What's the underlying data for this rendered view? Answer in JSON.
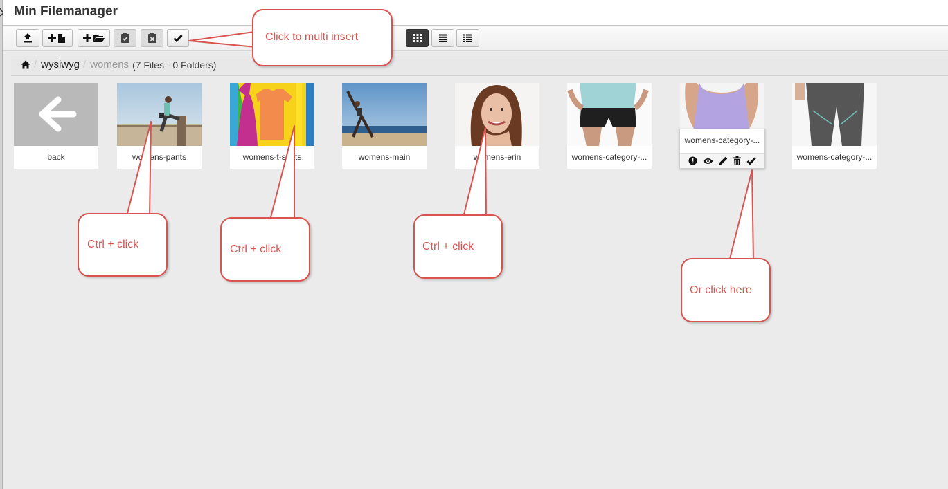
{
  "app": {
    "title": "Min Filemanager"
  },
  "toolbar": {
    "buttons": [
      {
        "name": "upload-button",
        "icon": "upload-icon"
      },
      {
        "name": "new-file-button",
        "icon": "plus-file-icon"
      },
      {
        "name": "new-folder-button",
        "icon": "plus-folder-icon"
      },
      {
        "name": "paste-button",
        "icon": "clipboard-check-icon",
        "disabled": true
      },
      {
        "name": "clear-clipboard-button",
        "icon": "clipboard-x-icon",
        "disabled": true
      },
      {
        "name": "multi-insert-button",
        "icon": "check-icon"
      }
    ],
    "views": [
      {
        "name": "view-boxes-button",
        "icon": "grid-icon",
        "active": true
      },
      {
        "name": "view-list-button",
        "icon": "list-icon"
      },
      {
        "name": "view-columns-button",
        "icon": "columns-list-icon"
      }
    ]
  },
  "breadcrumb": {
    "home_icon": "home-icon",
    "separator": "/",
    "items": [
      "wysiwyg"
    ],
    "current": "womens",
    "info": "(7 Files - 0 Folders)"
  },
  "files": [
    {
      "label": "back",
      "thumb": "back-arrow"
    },
    {
      "label": "womens-pants",
      "thumb": "photo-runner"
    },
    {
      "label": "womens-t-shirts",
      "thumb": "photo-tshirts"
    },
    {
      "label": "womens-main",
      "thumb": "photo-yoga-beach"
    },
    {
      "label": "womens-erin",
      "thumb": "photo-portrait"
    },
    {
      "label": "womens-category-...",
      "thumb": "photo-shorts"
    },
    {
      "label": "womens-category-...",
      "thumb": "photo-tank",
      "selected": true
    },
    {
      "label": "womens-category-...",
      "thumb": "photo-leggings"
    }
  ],
  "popover": {
    "label": "womens-category-...",
    "actions": [
      "info-icon",
      "preview-eye-icon",
      "rename-pencil-icon",
      "delete-trash-icon",
      "select-check-icon"
    ]
  },
  "callouts": {
    "multi_insert": "Click to multi insert",
    "ctrl_1": "Ctrl + click",
    "ctrl_2": "Ctrl + click",
    "ctrl_3": "Ctrl + click",
    "or_click": "Or click here"
  },
  "colors": {
    "callout": "#d9534f",
    "active_view": "#3a3a3a"
  }
}
